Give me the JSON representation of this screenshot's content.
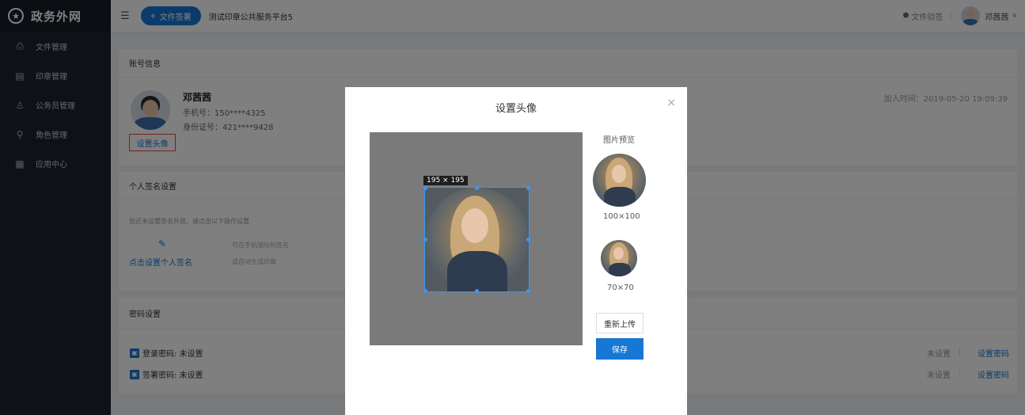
{
  "sidebar": {
    "logo_mark": "★",
    "logo_text": "政务外网",
    "items": [
      {
        "icon": "stamp-doc-icon",
        "glyph": "⎙",
        "label": "文件管理"
      },
      {
        "icon": "seal-icon",
        "glyph": "▤",
        "label": "印章管理"
      },
      {
        "icon": "user-icon",
        "glyph": "♙",
        "label": "公务员管理"
      },
      {
        "icon": "role-icon",
        "glyph": "⚲",
        "label": "角色管理"
      },
      {
        "icon": "apps-icon",
        "glyph": "▦",
        "label": "应用中心"
      }
    ]
  },
  "header": {
    "menu_glyph": "☰",
    "new_doc_label": "文件签署",
    "platform_name": "测试印章公共服务平台5",
    "verify_label": "文件验签",
    "user_name": "邓茜茜",
    "chevron": "∨"
  },
  "account": {
    "title": "账号信息",
    "name": "邓茜茜",
    "phone": "手机号：150****4325",
    "id_number": "身份证号：421****9428",
    "set_avatar": "设置头像",
    "join_time": "加入时间：2019-05-20 19:09:39"
  },
  "signature": {
    "title": "个人签名设置",
    "hint": "您还未设置签名外观，请点击以下操作设置",
    "link": "点击设置个人签名",
    "desc1": "可在手机端绘制签名",
    "desc2": "或自动生成印章"
  },
  "password": {
    "title": "密码设置",
    "rows": [
      {
        "label": "登录密码: 未设置",
        "status": "未设置",
        "action": "设置密码"
      },
      {
        "label": "签署密码: 未设置",
        "status": "未设置",
        "action": "设置密码"
      }
    ]
  },
  "modal": {
    "title": "设置头像",
    "close": "×",
    "crop_dimensions": "195 × 195",
    "preview_label": "图片预览",
    "preview_100": "100×100",
    "preview_70": "70×70",
    "reupload": "重新上传",
    "save": "保存"
  },
  "colors": {
    "primary": "#1677d4",
    "sidebar_bg": "#1d2330",
    "highlight_border": "#e14b4b"
  }
}
